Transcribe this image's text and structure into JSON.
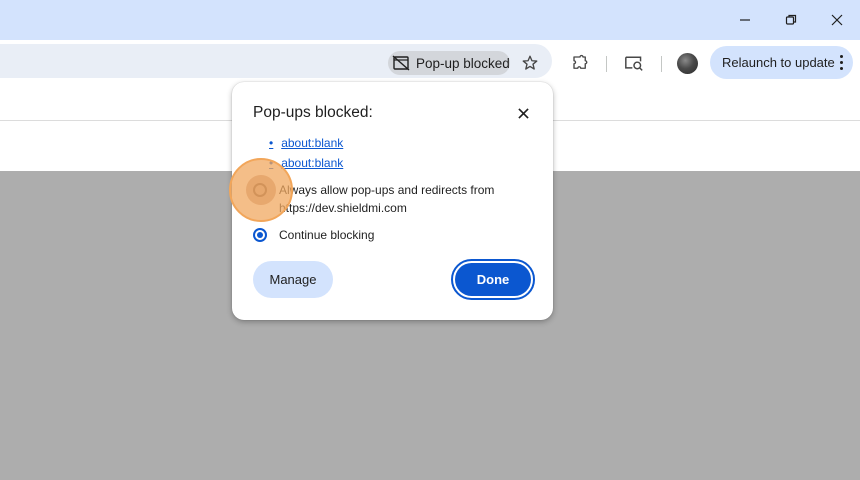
{
  "window": {
    "minimize_glyph": "—",
    "restore_glyph": "❐",
    "close_glyph": "✕"
  },
  "toolbar": {
    "popup_chip_label": "Pop-up blocked",
    "relaunch_label": "Relaunch to update",
    "icons": [
      "popup-blocked-icon",
      "star-icon",
      "extensions-icon",
      "cast-search-icon",
      "avatar",
      "more-icon"
    ]
  },
  "popup_bubble": {
    "title": "Pop-ups blocked:",
    "links": [
      {
        "bullet": "•",
        "label": "about:blank"
      },
      {
        "bullet": "•",
        "label": "about:blank"
      }
    ],
    "options": [
      {
        "label_line1": "Always allow pop-ups and redirects from",
        "label_line2": "https://dev.shieldmi.com",
        "checked": false
      },
      {
        "label_line1": "Continue blocking",
        "checked": true
      }
    ],
    "manage_label": "Manage",
    "done_label": "Done",
    "close_glyph": "✕"
  },
  "colors": {
    "titlebar": "#d3e3fd",
    "accent": "#0b57d0",
    "content_bg": "#adadad",
    "click_marker": "#f2a65a"
  }
}
